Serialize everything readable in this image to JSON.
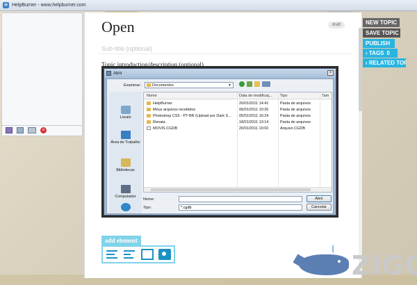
{
  "app": {
    "window_title": "HelpBurner - www.helpburner.com"
  },
  "editor": {
    "title": "Open",
    "badge": "draft",
    "subtitle_placeholder": "Sub-title (optional)",
    "intro_placeholder": "Topic introduction/description (optional)..."
  },
  "dialog": {
    "title": "Abrir",
    "look_in_label": "Examinar:",
    "look_in_value": "Documentos",
    "places": [
      "Locais",
      "Área de Trabalho",
      "Bibliotecas",
      "Computador",
      ""
    ],
    "columns": [
      "Nome",
      "Data de modificaç...",
      "Tipo",
      "Tam"
    ],
    "files": [
      {
        "name": "HelpBurner",
        "date": "20/01/2011 14:41",
        "type": "Pasta de arquivos",
        "kind": "folder"
      },
      {
        "name": "Meus arquivos recebidos",
        "date": "06/01/2011 10:30",
        "type": "Pasta de arquivos",
        "kind": "folder"
      },
      {
        "name": "Photoshop CS5 - PT-BR (Upload por Dark S...",
        "date": "05/01/2011 16:24",
        "type": "Pasta de arquivos",
        "kind": "folder"
      },
      {
        "name": "Renata",
        "date": "18/01/2011 13:14",
        "type": "Pasta de arquivos",
        "kind": "folder"
      },
      {
        "name": "MOVIS.CGDB",
        "date": "20/01/2011 10:00",
        "type": "Arquivo CGDB",
        "kind": "file"
      }
    ],
    "filename_label": "Nome:",
    "filename_value": "",
    "type_label": "Tipo:",
    "type_value": "*.cgdb",
    "open_button": "Abrir",
    "cancel_button": "Cancelar"
  },
  "add_element": {
    "label": "add element"
  },
  "actions": {
    "new_topic": "NEW TOPIC",
    "save_topic": "SAVE TOPIC",
    "publish": "PUBLISH",
    "tags": "‹ TAGS",
    "tags_count": "0",
    "related": "‹ RELATED TOPICS"
  },
  "watermark": {
    "text": "ZIGG"
  },
  "colors": {
    "accent": "#28b4e0",
    "dark_button": "#555555",
    "add_element": "#7fd3ea"
  }
}
